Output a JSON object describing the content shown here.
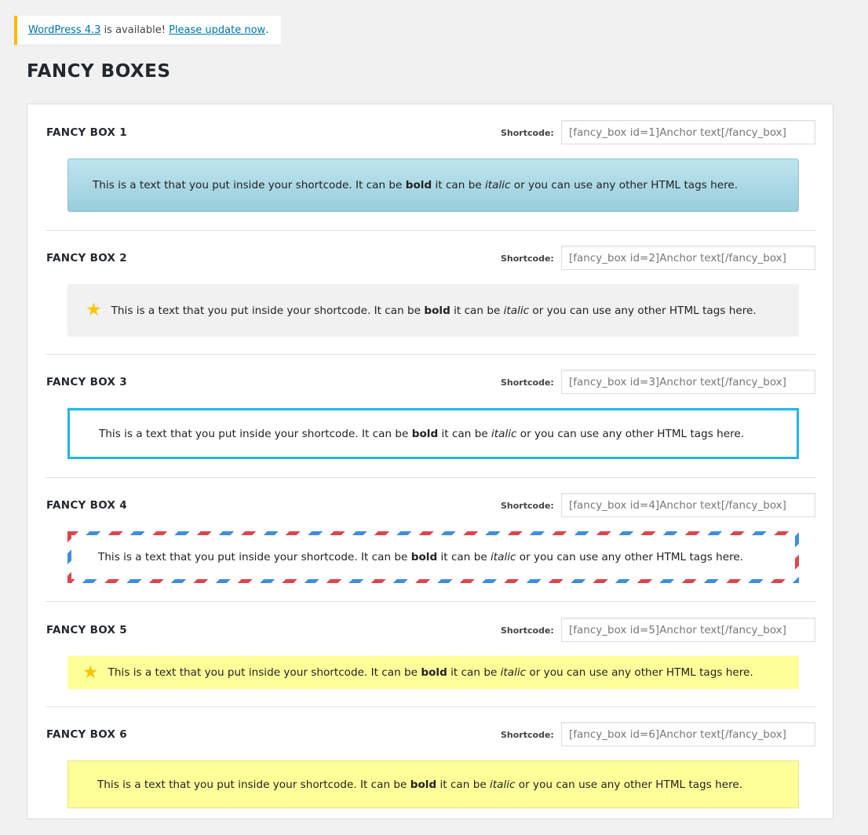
{
  "notice": {
    "link1": "WordPress 4.3",
    "middle": " is available! ",
    "link2": "Please update now",
    "end": "."
  },
  "page_title": "FANCY BOXES",
  "shortcode_label": "Shortcode:",
  "box_text": {
    "before": "This is a text that you put inside your shortcode. It can be ",
    "bold": "bold",
    "mid": " it can be ",
    "italic": "italic",
    "after": " or you can use any other HTML tags here."
  },
  "boxes": [
    {
      "title": "FANCY BOX 1",
      "shortcode": "[fancy_box id=1]Anchor text[/fancy_box]"
    },
    {
      "title": "FANCY BOX 2",
      "shortcode": "[fancy_box id=2]Anchor text[/fancy_box]",
      "icon": "star-icon"
    },
    {
      "title": "FANCY BOX 3",
      "shortcode": "[fancy_box id=3]Anchor text[/fancy_box]"
    },
    {
      "title": "FANCY BOX 4",
      "shortcode": "[fancy_box id=4]Anchor text[/fancy_box]"
    },
    {
      "title": "FANCY BOX 5",
      "shortcode": "[fancy_box id=5]Anchor text[/fancy_box]",
      "icon": "star-icon"
    },
    {
      "title": "FANCY BOX 6",
      "shortcode": "[fancy_box id=6]Anchor text[/fancy_box]"
    }
  ],
  "colors": {
    "notice_accent": "#ffba00",
    "link": "#0073aa",
    "box1_bg": "#a8d7e3",
    "box2_bg": "#f1f1f1",
    "box3_border": "#22b5e6",
    "box4_stripe_red": "#e0444b",
    "box4_stripe_blue": "#3d8ee0",
    "box5_bg": "#ffff99",
    "box6_bg": "#ffff99",
    "star": "#f7c600"
  }
}
